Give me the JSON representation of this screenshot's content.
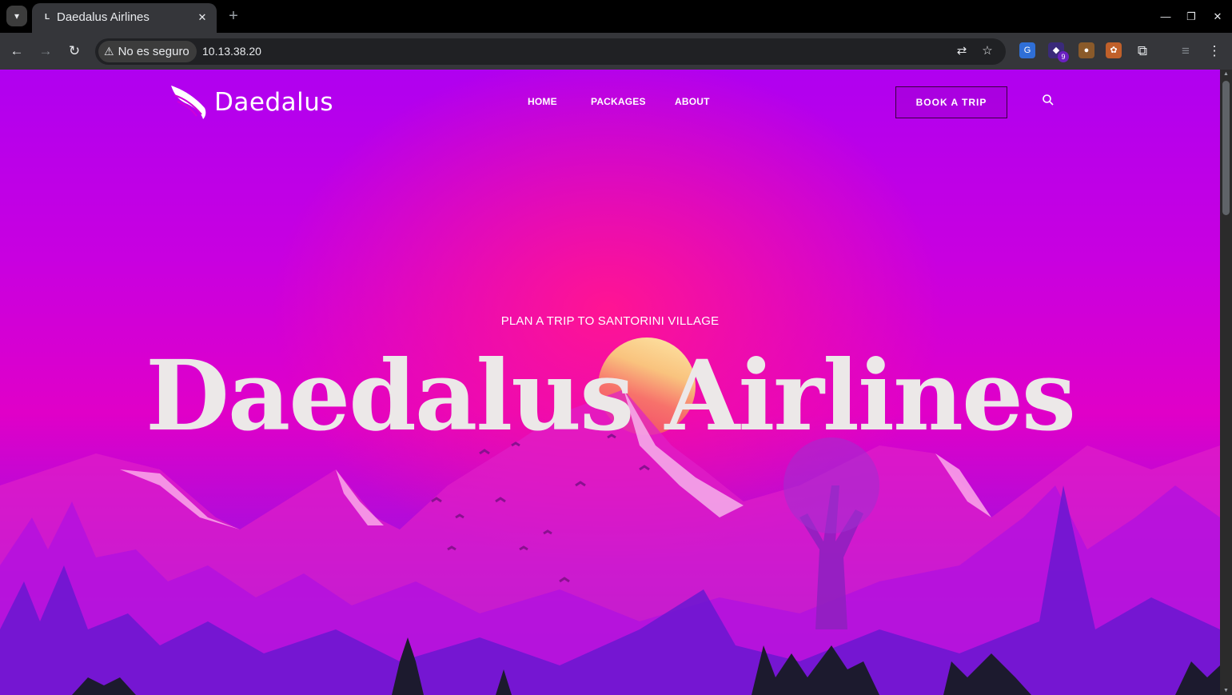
{
  "browser": {
    "tab": {
      "favicon": "L",
      "title": "Daedalus Airlines"
    },
    "security_label": "No es seguro",
    "url": "10.13.38.20",
    "extension_badge": "9"
  },
  "site": {
    "logo_text": "Daedalus",
    "nav": [
      "HOME",
      "PACKAGES",
      "ABOUT"
    ],
    "book_button": "BOOK A TRIP",
    "hero_eyebrow": "PLAN A TRIP TO SANTORINI VILLAGE",
    "hero_title": "Daedalus Airlines"
  },
  "colors": {
    "hero_top": "#b000f0",
    "hero_glow": "#ff1493",
    "hero_title": "#ece8e8"
  }
}
